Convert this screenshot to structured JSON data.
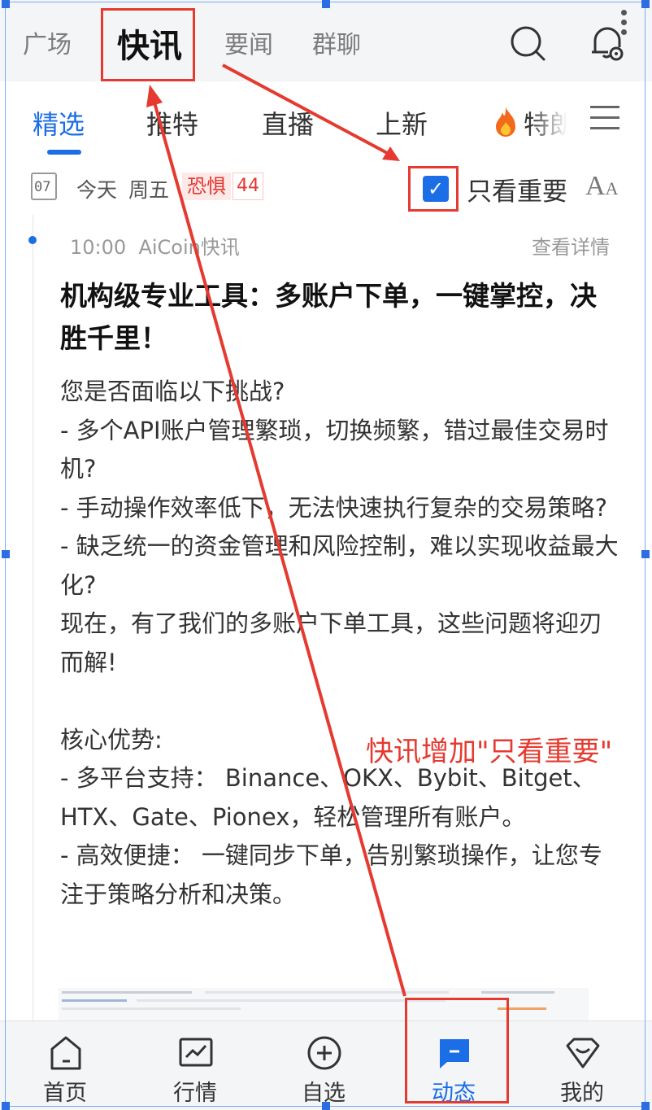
{
  "top_tabs": [
    "广场",
    "快讯",
    "要闻",
    "群聊"
  ],
  "sub_tabs": [
    "精选",
    "推特",
    "直播",
    "上新",
    "特朗"
  ],
  "date_row": {
    "calendar_day": "07",
    "today": "今天",
    "weekday": "周五",
    "fear_label": "恐惧",
    "fear_value": "44",
    "important_checked": true,
    "important_label": "只看重要",
    "font_size_label": "A"
  },
  "news": {
    "time": "10:00",
    "source": "AiCoin快讯",
    "detail_link": "查看详情",
    "headline": "机构级专业工具：多账户下单，一键掌控，决胜千里！",
    "body": "您是否面临以下挑战?\n- 多个API账户管理繁琐，切换频繁，错过最佳交易时机?\n- 手动操作效率低下，无法快速执行复杂的交易策略?\n- 缺乏统一的资金管理和风险控制，难以实现收益最大化?\n现在，有了我们的多账户下单工具，这些问题将迎刃而解!\n\n核心优势:\n- 多平台支持： Binance、OKX、Bybit、Bitget、HTX、Gate、Pionex，轻松管理所有账户。\n- 高效便捷： 一键同步下单，告别繁琐操作，让您专注于策略分析和决策。"
  },
  "annotation": "快讯增加\"只看重要\"",
  "bottom_nav": [
    "首页",
    "行情",
    "自选",
    "动态",
    "我的"
  ],
  "colors": {
    "accent": "#1b6ee6",
    "annotation_red": "#e53a2f",
    "fear_red": "#e3382f"
  }
}
